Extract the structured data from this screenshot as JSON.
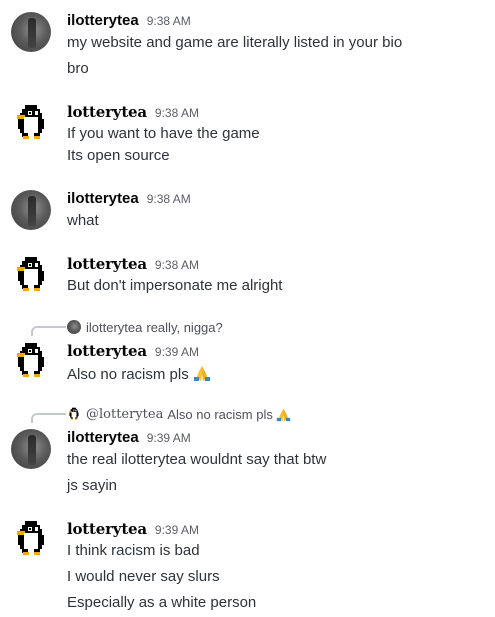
{
  "messages": [
    {
      "author": "ilotterytea",
      "time": "9:38 AM",
      "lines": [
        "my website and game are literally listed in your bio",
        "bro"
      ]
    },
    {
      "author": "lotterytea",
      "time": "9:38 AM",
      "lines": [
        "If you want to have the game",
        "Its open source"
      ]
    },
    {
      "author": "ilotterytea",
      "time": "9:38 AM",
      "lines": [
        "what"
      ]
    },
    {
      "author": "lotterytea",
      "time": "9:38 AM",
      "lines": [
        "But don't impersonate me alright"
      ]
    },
    {
      "author": "lotterytea",
      "time": "9:39 AM",
      "reply": {
        "author": "ilotterytea",
        "text": "really, nigga?"
      },
      "lines": [
        "Also no racism pls"
      ],
      "emoji": "folded-hands"
    },
    {
      "author": "ilotterytea",
      "time": "9:39 AM",
      "reply": {
        "author": "@lotterytea",
        "text": "Also no racism pls"
      },
      "lines": [
        "the real ilotterytea wouldnt say that btw",
        "js sayin"
      ]
    },
    {
      "author": "lotterytea",
      "time": "9:39 AM",
      "lines": [
        "I think racism is bad",
        "I would never say slurs",
        "Especially as a white person"
      ]
    }
  ],
  "icons": {
    "avatar_photo": "profile-photo-avatar",
    "avatar_penguin": "pixel-penguin-avatar",
    "emoji": "folded-hands-emoji"
  }
}
